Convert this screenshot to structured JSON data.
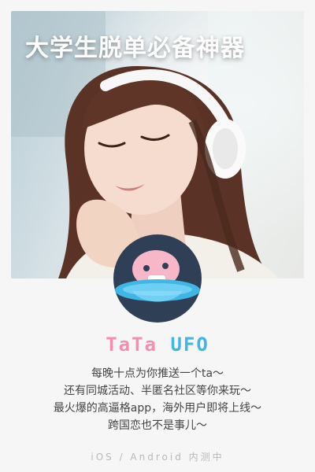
{
  "headline": "大学生脱单必备神器",
  "brand": {
    "part1": "TaTa",
    "part2": "UFO",
    "color1": "#f58db0",
    "color2": "#3fb7e6"
  },
  "description": [
    "每晚十点为你推送一个ta～",
    "还有同城活动、半匿名社区等你来玩～",
    "最火爆的高逼格app，海外用户即将上线～",
    "跨国恋也不是事儿～"
  ],
  "footer": "iOS / Android 内测中"
}
